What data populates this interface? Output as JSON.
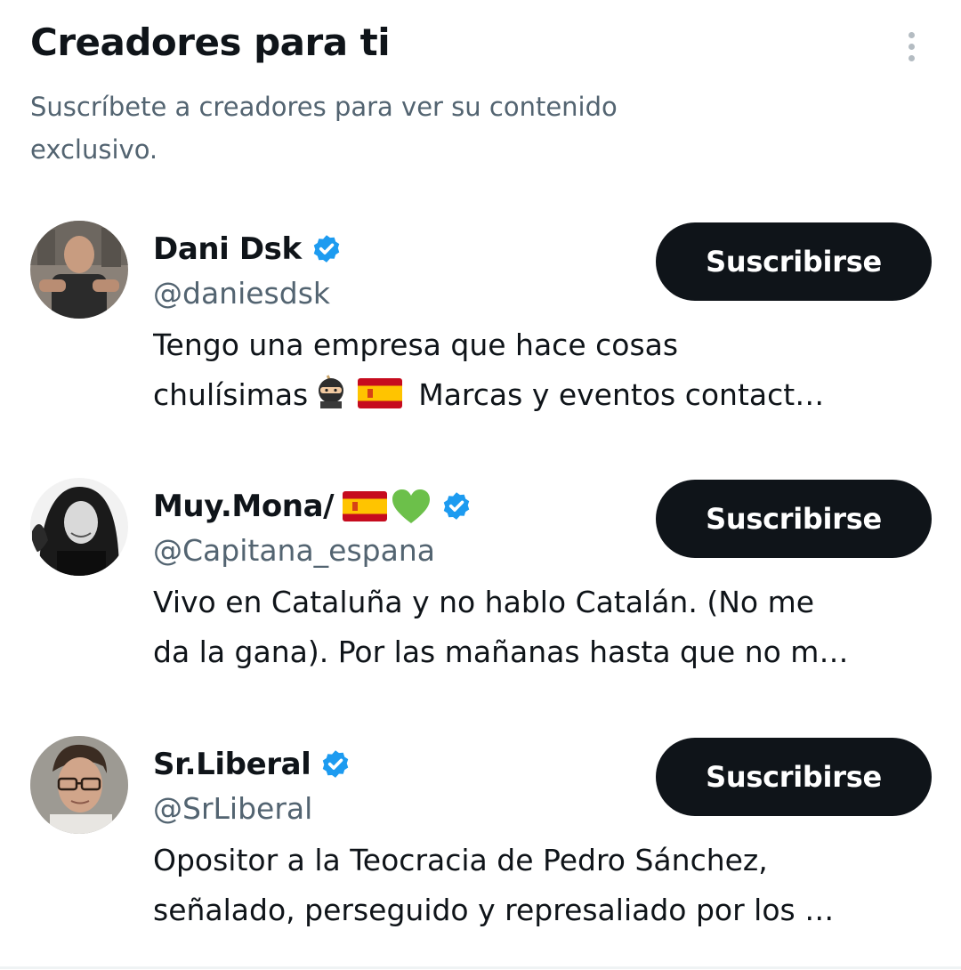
{
  "section": {
    "title": "Creadores para ti",
    "subtitle": "Suscríbete a creadores para ver su contenido exclusivo.",
    "more_icon": "vertical-ellipsis-icon"
  },
  "colors": {
    "text_primary": "#0f1419",
    "text_secondary": "#536471",
    "button_bg": "#0f1419",
    "button_text": "#ffffff",
    "verified_badge": "#1d9bf0"
  },
  "creators": [
    {
      "name": "Dani Dsk",
      "handle": "@daniesdsk",
      "verified": true,
      "bio_line1": "Tengo una empresa que hace cosas",
      "bio_line2_before": "chulísimas",
      "bio_line2_emojis": [
        "ninja-emoji",
        "spain-flag-emoji"
      ],
      "bio_line2_after": "Marcas y eventos contact…",
      "button_label": "Suscribirse"
    },
    {
      "name": "Muy.Mona/",
      "name_emojis": [
        "spain-flag-emoji",
        "green-heart-emoji"
      ],
      "handle": "@Capitana_espana",
      "verified": true,
      "bio_line1": "Vivo en Cataluña y no hablo Catalán. (No me",
      "bio_line2": "da la gana). Por las mañanas hasta que no m…",
      "button_label": "Suscribirse"
    },
    {
      "name": "Sr.Liberal",
      "handle": "@SrLiberal",
      "verified": true,
      "bio_line1": "Opositor a la Teocracia de Pedro Sánchez,",
      "bio_line2": "señalado, perseguido y represaliado por los …",
      "button_label": "Suscribirse"
    }
  ]
}
